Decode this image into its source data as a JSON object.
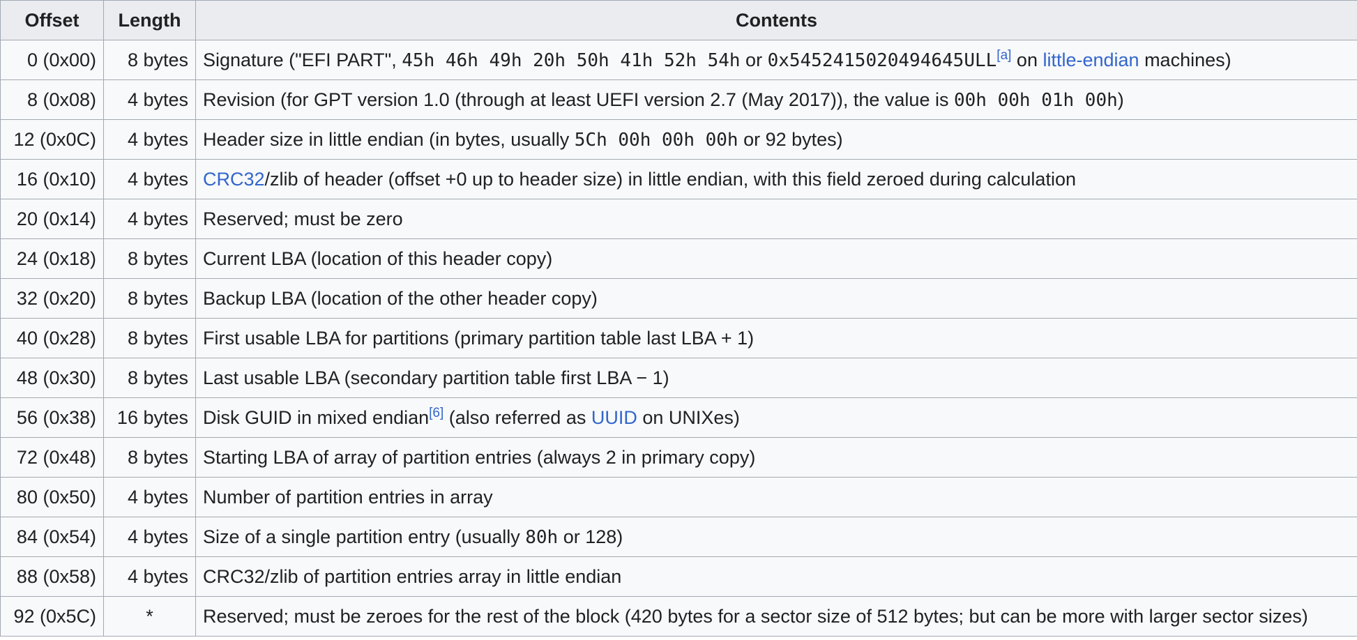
{
  "table": {
    "headers": {
      "offset": "Offset",
      "length": "Length",
      "contents": "Contents"
    },
    "rows": [
      {
        "offset": "0 (0x00)",
        "length": "8 bytes",
        "contents": [
          {
            "t": "text",
            "v": "Signature (\"EFI PART\", "
          },
          {
            "t": "code",
            "v": "45h 46h 49h 20h 50h 41h 52h 54h"
          },
          {
            "t": "text",
            "v": " or "
          },
          {
            "t": "code",
            "v": "0x5452415020494645ULL"
          },
          {
            "t": "sup",
            "v": "[a]"
          },
          {
            "t": "text",
            "v": " on "
          },
          {
            "t": "link",
            "v": "little-endian"
          },
          {
            "t": "text",
            "v": " machines)"
          }
        ]
      },
      {
        "offset": "8 (0x08)",
        "length": "4 bytes",
        "contents": [
          {
            "t": "text",
            "v": "Revision (for GPT version 1.0 (through at least UEFI version 2.7 (May 2017)), the value is "
          },
          {
            "t": "code",
            "v": "00h 00h 01h 00h"
          },
          {
            "t": "text",
            "v": ")"
          }
        ]
      },
      {
        "offset": "12 (0x0C)",
        "length": "4 bytes",
        "contents": [
          {
            "t": "text",
            "v": "Header size in little endian (in bytes, usually "
          },
          {
            "t": "code",
            "v": "5Ch 00h 00h 00h"
          },
          {
            "t": "text",
            "v": " or 92 bytes)"
          }
        ]
      },
      {
        "offset": "16 (0x10)",
        "length": "4 bytes",
        "contents": [
          {
            "t": "link",
            "v": "CRC32"
          },
          {
            "t": "text",
            "v": "/zlib of header (offset +0 up to header size) in little endian, with this field zeroed during calculation"
          }
        ]
      },
      {
        "offset": "20 (0x14)",
        "length": "4 bytes",
        "contents": [
          {
            "t": "text",
            "v": "Reserved; must be zero"
          }
        ]
      },
      {
        "offset": "24 (0x18)",
        "length": "8 bytes",
        "contents": [
          {
            "t": "text",
            "v": "Current LBA (location of this header copy)"
          }
        ]
      },
      {
        "offset": "32 (0x20)",
        "length": "8 bytes",
        "contents": [
          {
            "t": "text",
            "v": "Backup LBA (location of the other header copy)"
          }
        ]
      },
      {
        "offset": "40 (0x28)",
        "length": "8 bytes",
        "contents": [
          {
            "t": "text",
            "v": "First usable LBA for partitions (primary partition table last LBA + 1)"
          }
        ]
      },
      {
        "offset": "48 (0x30)",
        "length": "8 bytes",
        "contents": [
          {
            "t": "text",
            "v": "Last usable LBA (secondary partition table first LBA − 1)"
          }
        ]
      },
      {
        "offset": "56 (0x38)",
        "length": "16 bytes",
        "contents": [
          {
            "t": "text",
            "v": "Disk GUID in mixed endian"
          },
          {
            "t": "sup",
            "v": "[6]"
          },
          {
            "t": "text",
            "v": " (also referred as "
          },
          {
            "t": "link",
            "v": "UUID"
          },
          {
            "t": "text",
            "v": " on UNIXes)"
          }
        ]
      },
      {
        "offset": "72 (0x48)",
        "length": "8 bytes",
        "contents": [
          {
            "t": "text",
            "v": "Starting LBA of array of partition entries (always 2 in primary copy)"
          }
        ]
      },
      {
        "offset": "80 (0x50)",
        "length": "4 bytes",
        "contents": [
          {
            "t": "text",
            "v": "Number of partition entries in array"
          }
        ]
      },
      {
        "offset": "84 (0x54)",
        "length": "4 bytes",
        "contents": [
          {
            "t": "text",
            "v": "Size of a single partition entry (usually "
          },
          {
            "t": "code",
            "v": "80h"
          },
          {
            "t": "text",
            "v": " or 128)"
          }
        ]
      },
      {
        "offset": "88 (0x58)",
        "length": "4 bytes",
        "contents": [
          {
            "t": "text",
            "v": "CRC32/zlib of partition entries array in little endian"
          }
        ]
      },
      {
        "offset": "92 (0x5C)",
        "length": "*",
        "contents": [
          {
            "t": "text",
            "v": "Reserved; must be zeroes for the rest of the block (420 bytes for a sector size of 512 bytes; but can be more with larger sector sizes)"
          }
        ]
      }
    ]
  }
}
